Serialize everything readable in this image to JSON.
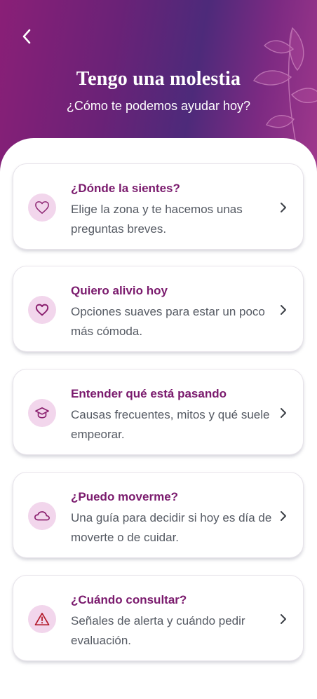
{
  "header": {
    "title": "Tengo una molestia",
    "subtitle": "¿Cómo te podemos ayudar hoy?",
    "back_icon": "chevron-left-icon"
  },
  "colors": {
    "header_gradient_start": "#8a1f77",
    "header_gradient_mid": "#4d2a7a",
    "accent_title": "#7a1a6d",
    "icon_bg": "#f2d6ec",
    "icon_stroke": "#8a1f6e",
    "alert_stroke": "#b31c2c"
  },
  "cards": [
    {
      "title": "¿Dónde la sientes?",
      "description": "Elige la zona y te hacemos unas preguntas breves.",
      "icon": "heart-outline-icon"
    },
    {
      "title": "Quiero alivio hoy",
      "description": "Opciones suaves para estar un poco más cómoda.",
      "icon": "heart-icon"
    },
    {
      "title": "Entender qué está pasando",
      "description": "Causas frecuentes, mitos y qué suele empeorar.",
      "icon": "graduation-cap-icon"
    },
    {
      "title": "¿Puedo moverme?",
      "description": "Una guía para decidir si hoy es día de moverte o de cuidar.",
      "icon": "cloud-icon"
    },
    {
      "title": "¿Cuándo consultar?",
      "description": "Señales de alerta y cuándo pedir evaluación.",
      "icon": "alert-triangle-icon"
    }
  ]
}
